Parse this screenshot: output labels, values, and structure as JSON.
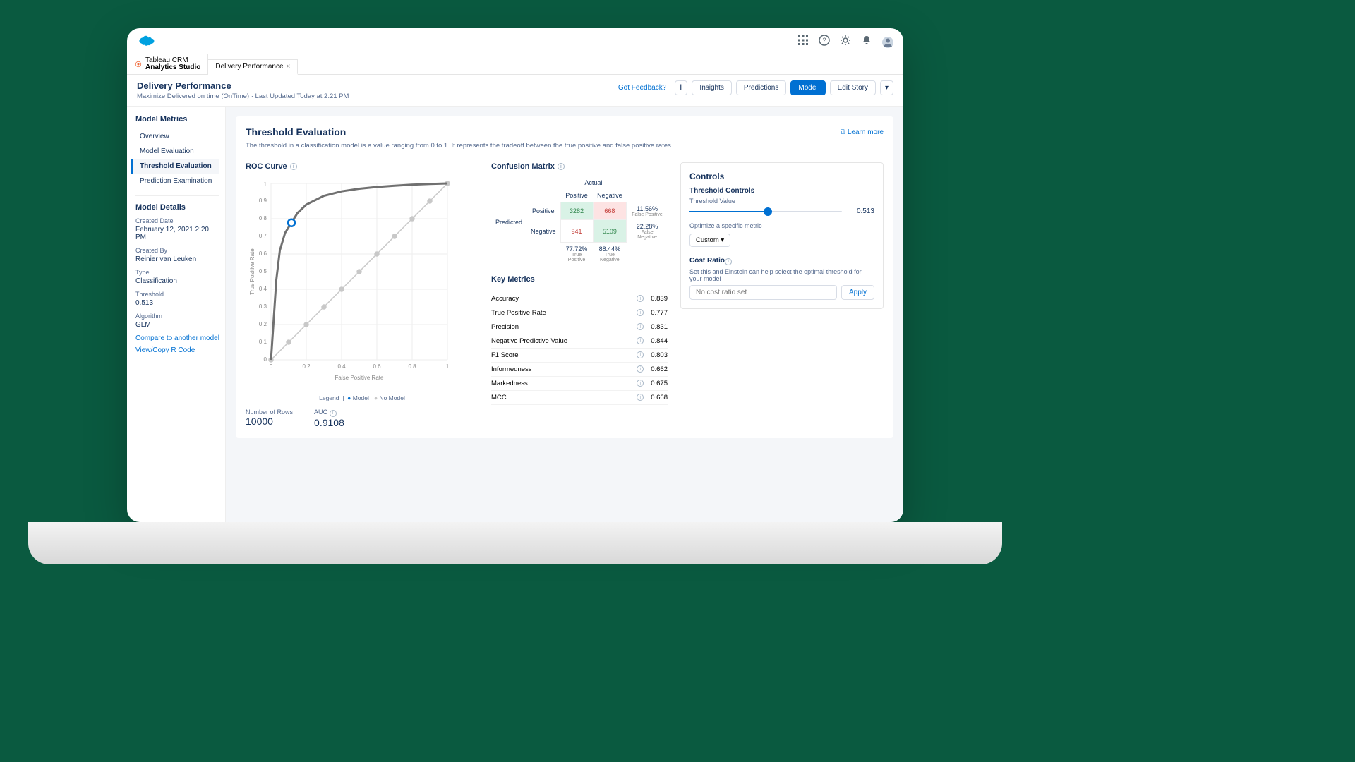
{
  "topbar": {
    "icons": [
      "apps",
      "help",
      "settings",
      "notifications",
      "avatar"
    ]
  },
  "tabs": {
    "app": {
      "line1": "Tableau CRM",
      "line2": "Analytics Studio"
    },
    "open": {
      "label": "Delivery Performance"
    }
  },
  "subheader": {
    "title": "Delivery Performance",
    "subtitle": "Maximize Delivered on time (OnTime) · Last Updated Today at 2:21 PM",
    "buttons": {
      "feedback": "Got Feedback?",
      "insights": "Insights",
      "predictions": "Predictions",
      "model": "Model",
      "editStory": "Edit Story"
    }
  },
  "sidebar": {
    "heading": "Model Metrics",
    "items": [
      "Overview",
      "Model Evaluation",
      "Threshold Evaluation",
      "Prediction Examination"
    ],
    "activeIndex": 2,
    "details": {
      "heading": "Model Details",
      "createdDateLabel": "Created Date",
      "createdDate": "February 12, 2021 2:20 PM",
      "createdByLabel": "Created By",
      "createdBy": "Reinier van Leuken",
      "typeLabel": "Type",
      "type": "Classification",
      "thresholdLabel": "Threshold",
      "threshold": "0.513",
      "algorithmLabel": "Algorithm",
      "algorithm": "GLM"
    },
    "links": {
      "compare": "Compare to another model",
      "viewR": "View/Copy R Code"
    }
  },
  "content": {
    "title": "Threshold Evaluation",
    "desc": "The threshold in a classification model is a value ranging from 0 to 1. It represents the tradeoff between the true positive and false positive rates.",
    "learnMore": "Learn more"
  },
  "roc": {
    "title": "ROC Curve",
    "xlabel": "False Positive Rate",
    "ylabel": "True Positive Rate",
    "legend": {
      "prefix": "Legend",
      "model": "Model",
      "noModel": "No Model"
    },
    "numRowsLabel": "Number of Rows",
    "numRows": "10000",
    "aucLabel": "AUC",
    "auc": "0.9108"
  },
  "confusion": {
    "title": "Confusion Matrix",
    "actual": "Actual",
    "predicted": "Predicted",
    "positive": "Positive",
    "negative": "Negative",
    "tp": "3282",
    "fn": "668",
    "fp": "941",
    "tn": "5109",
    "fpPct": "11.56%",
    "fpLbl": "False Positive",
    "fnPct": "22.28%",
    "fnLbl": "False Negative",
    "tpPct": "77.72%",
    "tpLbl": "True Positive",
    "tnPct": "88.44%",
    "tnLbl": "True Negative"
  },
  "keyMetrics": {
    "title": "Key Metrics",
    "rows": [
      {
        "label": "Accuracy",
        "value": "0.839"
      },
      {
        "label": "True Positive Rate",
        "value": "0.777"
      },
      {
        "label": "Precision",
        "value": "0.831"
      },
      {
        "label": "Negative Predictive Value",
        "value": "0.844"
      },
      {
        "label": "F1 Score",
        "value": "0.803"
      },
      {
        "label": "Informedness",
        "value": "0.662"
      },
      {
        "label": "Markedness",
        "value": "0.675"
      },
      {
        "label": "MCC",
        "value": "0.668"
      }
    ]
  },
  "controls": {
    "heading": "Controls",
    "thresholdControls": "Threshold Controls",
    "thresholdValueLabel": "Threshold Value",
    "thresholdValue": "0.513",
    "optimizeLabel": "Optimize a specific metric",
    "optimizeValue": "Custom",
    "costRatioLabel": "Cost Ratio",
    "costRatioHelp": "Set this and Einstein can help select the optimal threshold for your model",
    "costRatioPlaceholder": "No cost ratio set",
    "apply": "Apply"
  },
  "chart_data": {
    "type": "line",
    "title": "ROC Curve",
    "xlabel": "False Positive Rate",
    "ylabel": "True Positive Rate",
    "xlim": [
      0,
      1
    ],
    "ylim": [
      0,
      1
    ],
    "series": [
      {
        "name": "Model",
        "x": [
          0,
          0.02,
          0.03,
          0.05,
          0.08,
          0.116,
          0.15,
          0.2,
          0.3,
          0.4,
          0.5,
          0.6,
          0.7,
          0.8,
          0.9,
          1.0
        ],
        "y": [
          0,
          0.3,
          0.45,
          0.62,
          0.72,
          0.777,
          0.83,
          0.88,
          0.93,
          0.955,
          0.97,
          0.98,
          0.987,
          0.993,
          0.997,
          1.0
        ]
      },
      {
        "name": "No Model",
        "x": [
          0,
          0.1,
          0.2,
          0.3,
          0.4,
          0.5,
          0.6,
          0.7,
          0.8,
          0.9,
          1.0
        ],
        "y": [
          0,
          0.1,
          0.2,
          0.3,
          0.4,
          0.5,
          0.6,
          0.7,
          0.8,
          0.9,
          1.0
        ]
      }
    ],
    "threshold_point": {
      "fpr": 0.116,
      "tpr": 0.777
    },
    "auc": 0.9108
  }
}
